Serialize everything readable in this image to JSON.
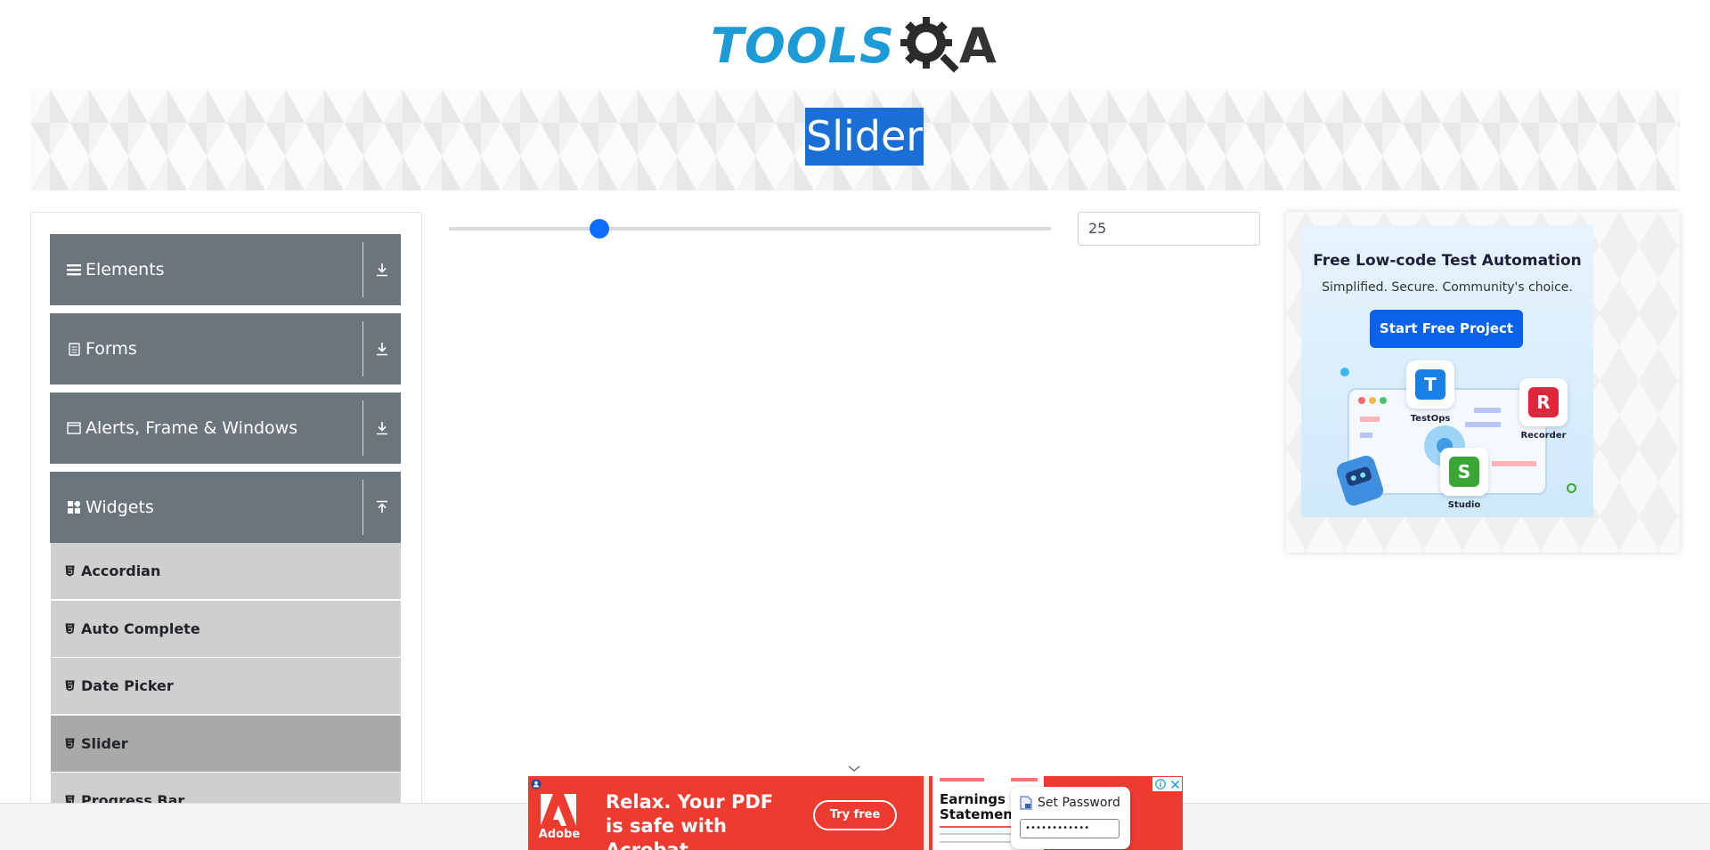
{
  "logo": {
    "text": "TOOLS",
    "suffix": "A"
  },
  "banner": {
    "title": "Slider"
  },
  "sidebar": {
    "groups": [
      {
        "label": "Elements",
        "icon": "menu-icon",
        "toggle": "download-icon"
      },
      {
        "label": "Forms",
        "icon": "form-icon",
        "toggle": "download-icon"
      },
      {
        "label": "Alerts, Frame & Windows",
        "icon": "window-icon",
        "toggle": "download-icon"
      },
      {
        "label": "Widgets",
        "icon": "widgets-icon",
        "toggle": "upload-icon"
      }
    ],
    "widget_items": [
      {
        "label": "Accordian"
      },
      {
        "label": "Auto Complete"
      },
      {
        "label": "Date Picker"
      },
      {
        "label": "Slider",
        "active": true
      },
      {
        "label": "Progress Bar"
      }
    ]
  },
  "slider": {
    "min": 0,
    "max": 100,
    "value": 25,
    "value_text": "25"
  },
  "right_ad": {
    "headline": "Free Low-code Test Automation",
    "subline": "Simplified. Secure. Community's choice.",
    "cta": "Start Free Project",
    "products": [
      {
        "name": "TestOps",
        "letter": "T",
        "color": "#1a7fe6"
      },
      {
        "name": "Recorder",
        "letter": "R",
        "color": "#e0263a"
      },
      {
        "name": "Studio",
        "letter": "S",
        "color": "#3aa635"
      }
    ]
  },
  "bottom_ad": {
    "brand": "Adobe",
    "slogan": "Relax. Your PDF is safe with Acrobat.",
    "cta": "Try free",
    "doc_title": "Earnings Statement",
    "password_label": "Set Password",
    "password_value": "••••••••••••",
    "accent": "#ee3b2f"
  },
  "colors": {
    "brand_blue": "#1d9bd6",
    "sidebar_group": "#6c757d",
    "slider_thumb": "#0d6efd",
    "selection": "#1a6fd6"
  }
}
